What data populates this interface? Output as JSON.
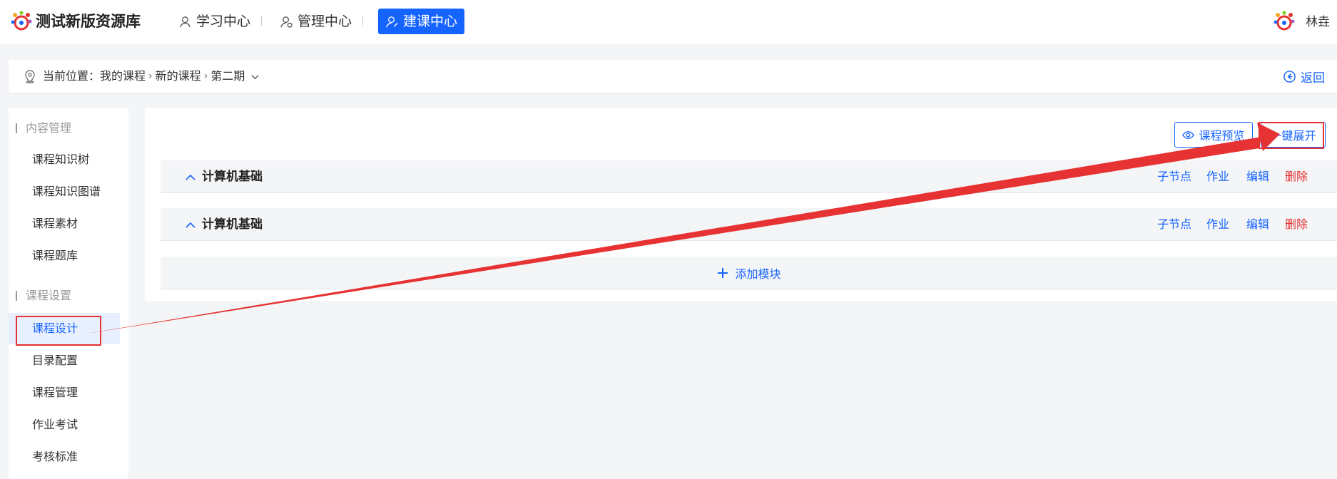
{
  "header": {
    "app_title": "测试新版资源库",
    "nav": [
      {
        "label": "学习中心",
        "icon": "user-icon",
        "active": false
      },
      {
        "label": "管理中心",
        "icon": "user-gear-icon",
        "active": false
      },
      {
        "label": "建课中心",
        "icon": "user-edit-icon",
        "active": true
      }
    ],
    "user_name": "林垚"
  },
  "breadcrumb": {
    "prefix": "当前位置：",
    "items": [
      "我的课程",
      "新的课程",
      "第二期"
    ],
    "back_label": "返回"
  },
  "sidebar": {
    "groups": [
      {
        "title": "内容管理",
        "items": [
          "课程知识树",
          "课程知识图谱",
          "课程素材",
          "课程题库"
        ]
      },
      {
        "title": "课程设置",
        "items": [
          "课程设计",
          "目录配置",
          "课程管理",
          "作业考试",
          "考核标准"
        ]
      }
    ],
    "active_item": "课程设计"
  },
  "main": {
    "preview_label": "课程预览",
    "expand_label": "一键展开",
    "modules": [
      {
        "title": "计算机基础",
        "actions": [
          "子节点",
          "作业",
          "编辑",
          "删除"
        ]
      },
      {
        "title": "计算机基础",
        "actions": [
          "子节点",
          "作业",
          "编辑",
          "删除"
        ]
      }
    ],
    "add_module_label": "添加模块"
  },
  "colors": {
    "accent": "#1664ff",
    "danger": "#e63232",
    "annotation": "#e63232"
  }
}
